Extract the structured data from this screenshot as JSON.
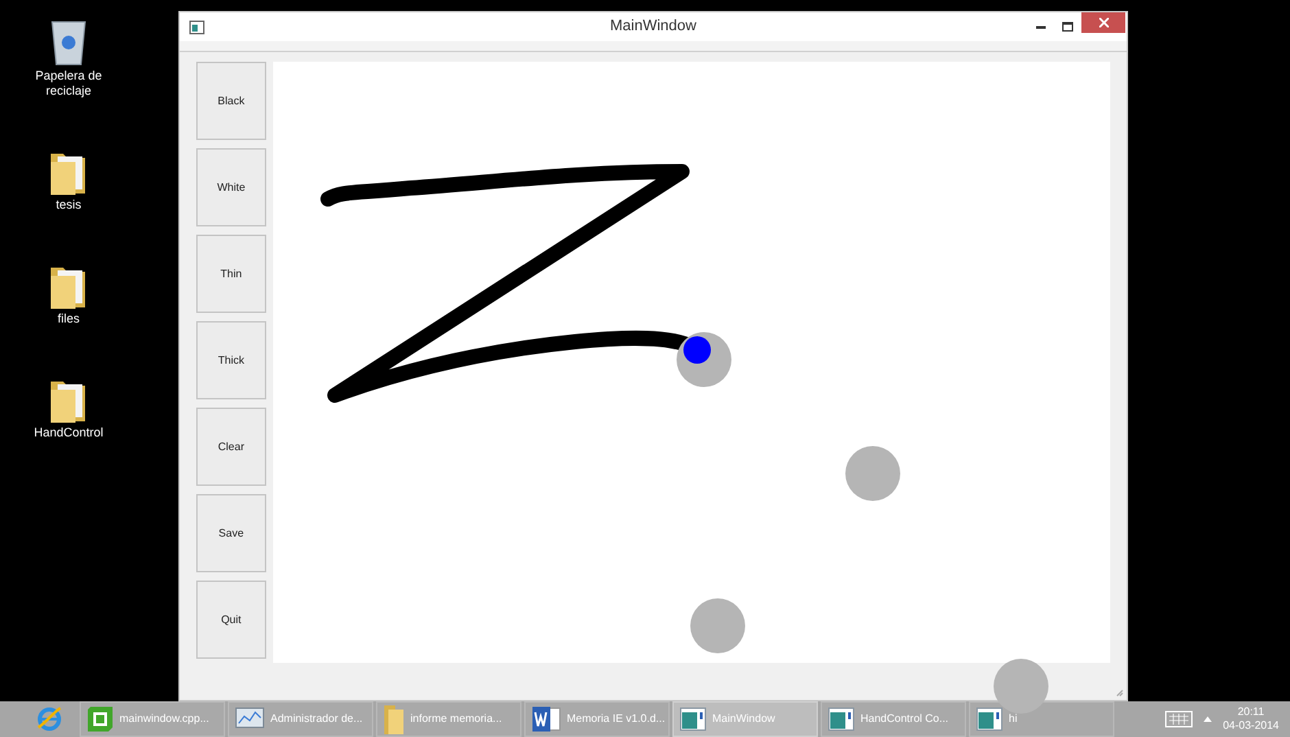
{
  "desktop_icons": [
    {
      "label": "Papelera de reciclaje",
      "kind": "bin"
    },
    {
      "label": "tesis",
      "kind": "folder"
    },
    {
      "label": "files",
      "kind": "folder"
    },
    {
      "label": "HandControl",
      "kind": "folder"
    }
  ],
  "window": {
    "title": "MainWindow"
  },
  "buttons": [
    "Black",
    "White",
    "Thin",
    "Thick",
    "Clear",
    "Save",
    "Quit"
  ],
  "taskbar": {
    "items": [
      {
        "label": "mainwindow.cpp...",
        "kind": "qt",
        "selected": false
      },
      {
        "label": "Administrador de...",
        "kind": "monitor",
        "selected": false
      },
      {
        "label": "informe memoria...",
        "kind": "folder",
        "selected": false
      },
      {
        "label": "Memoria IE v1.0.d...",
        "kind": "word",
        "selected": false
      },
      {
        "label": "MainWindow",
        "kind": "app",
        "selected": true
      },
      {
        "label": "HandControl Co...",
        "kind": "app",
        "selected": false
      },
      {
        "label": "hi",
        "kind": "app",
        "selected": false
      }
    ],
    "time": "20:11",
    "date": "04-03-2014"
  }
}
